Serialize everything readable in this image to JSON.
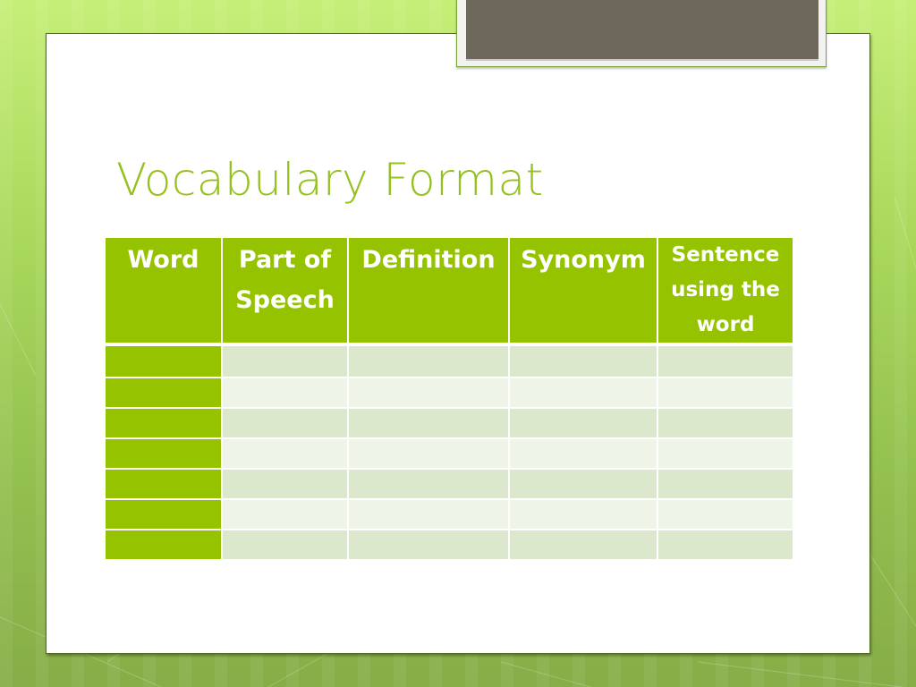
{
  "slide": {
    "title": "Vocabulary Format",
    "colors": {
      "accent": "#95c300",
      "title_text": "#94c11e",
      "row_dark": "#dce8cb",
      "row_light": "#eef4e8",
      "tab_fill": "#6e675b",
      "background_green": "#a9d85c"
    }
  },
  "table": {
    "headers": [
      {
        "label": "Word"
      },
      {
        "label": "Part of Speech"
      },
      {
        "label": "Definition"
      },
      {
        "label": "Synonym"
      },
      {
        "label": "Sentence using the word"
      }
    ],
    "rows": [
      [
        "",
        "",
        "",
        "",
        ""
      ],
      [
        "",
        "",
        "",
        "",
        ""
      ],
      [
        "",
        "",
        "",
        "",
        ""
      ],
      [
        "",
        "",
        "",
        "",
        ""
      ],
      [
        "",
        "",
        "",
        "",
        ""
      ],
      [
        "",
        "",
        "",
        "",
        ""
      ],
      [
        "",
        "",
        "",
        "",
        ""
      ]
    ]
  }
}
